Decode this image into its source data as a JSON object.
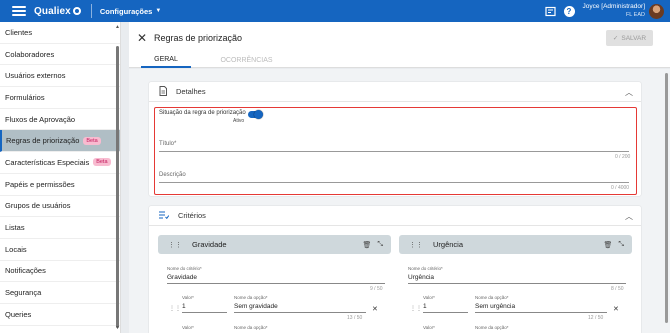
{
  "topbar": {
    "logo_text": "Qualiex",
    "module": "Configurações",
    "user_name": "Joyce [Administrador]",
    "user_role": "FL EAD",
    "help_symbol": "?"
  },
  "sidebar": {
    "items": [
      {
        "label": "Clientes"
      },
      {
        "label": "Colaboradores"
      },
      {
        "label": "Usuários externos"
      },
      {
        "label": "Formulários"
      },
      {
        "label": "Fluxos de Aprovação"
      },
      {
        "label": "Regras de priorização",
        "badge": "Beta",
        "active": true
      },
      {
        "label": "Características Especiais",
        "badge": "Beta"
      },
      {
        "label": "Papéis e permissões"
      },
      {
        "label": "Grupos de usuários"
      },
      {
        "label": "Listas"
      },
      {
        "label": "Locais"
      },
      {
        "label": "Notificações"
      },
      {
        "label": "Segurança"
      },
      {
        "label": "Queries"
      }
    ]
  },
  "header": {
    "title": "Regras de priorização",
    "save_label": "SALVAR",
    "tabs": [
      {
        "label": "GERAL",
        "active": true
      },
      {
        "label": "OCORRÊNCIAS",
        "active": false
      }
    ]
  },
  "details": {
    "title": "Detalhes",
    "situacao_label": "Situação da regra de priorização",
    "status_label": "Ativo",
    "status_on": true,
    "titulo_label": "Título*",
    "titulo_counter": "0 / 200",
    "descricao_label": "Descrição",
    "descricao_counter": "0 / 4000"
  },
  "criterios": {
    "title": "Critérios",
    "items": [
      {
        "header": "Gravidade",
        "name_label": "Nome do critério*",
        "name_value": "Gravidade",
        "name_counter": "9 / 50",
        "valor_label": "Valor*",
        "valor_value": "1",
        "opcao_label": "Nome da opção*",
        "opcao_value": "Sem gravidade",
        "opcao_counter": "13 / 50",
        "next_valor_label": "Valor*",
        "next_opcao_label": "Nome da opção*"
      },
      {
        "header": "Urgência",
        "name_label": "Nome do critério*",
        "name_value": "Urgência",
        "name_counter": "8 / 50",
        "valor_label": "Valor*",
        "valor_value": "1",
        "opcao_label": "Nome da opção*",
        "opcao_value": "Sem urgência",
        "opcao_counter": "12 / 50",
        "next_valor_label": "Valor*",
        "next_opcao_label": "Nome da opção*"
      }
    ]
  },
  "colors": {
    "primary": "#1565c0",
    "highlight_border": "#e53935",
    "beta_badge_bg": "#f8bbd0",
    "active_item_bg": "#b0bec5",
    "criteria_header_bg": "#cfd8dc"
  },
  "icons": {
    "menu": "hamburger-icon",
    "close": "close-icon",
    "save": "check-icon",
    "details": "document-icon",
    "criteria": "checklist-icon",
    "collapse": "chevron-up-icon",
    "drag": "drag-handle-icon",
    "delete": "trash-icon",
    "shrink": "collapse-arrows-icon",
    "remove_option": "close-icon"
  }
}
